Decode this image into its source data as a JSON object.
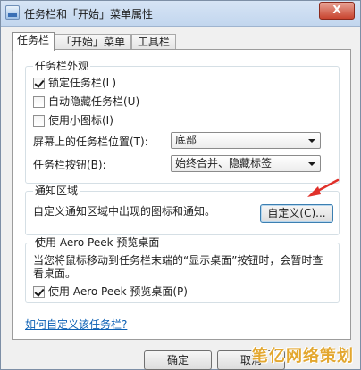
{
  "window": {
    "title": "任务栏和「开始」菜单属性",
    "close_label": "X"
  },
  "tabs": [
    {
      "label": "任务栏"
    },
    {
      "label": "「开始」菜单"
    },
    {
      "label": "工具栏"
    }
  ],
  "appearance": {
    "group_title": "任务栏外观",
    "lock_taskbar": {
      "label": "锁定任务栏(L)",
      "checked": true
    },
    "auto_hide": {
      "label": "自动隐藏任务栏(U)",
      "checked": false
    },
    "small_icons": {
      "label": "使用小图标(I)",
      "checked": false
    },
    "location_label": "屏幕上的任务栏位置(T):",
    "location_value": "底部",
    "buttons_label": "任务栏按钮(B):",
    "buttons_value": "始终合并、隐藏标签"
  },
  "notification": {
    "group_title": "通知区域",
    "description": "自定义通知区域中出现的图标和通知。",
    "customize_label": "自定义(C)..."
  },
  "aero_peek": {
    "group_title": "使用 Aero Peek 预览桌面",
    "description": "当您将鼠标移动到任务栏末端的“显示桌面”按钮时，会暂时查看桌面。",
    "checkbox": {
      "label": "使用 Aero Peek 预览桌面(P)",
      "checked": true
    }
  },
  "help_link": "如何自定义该任务栏?",
  "footer": {
    "ok_label": "确定",
    "cancel_label": "取消"
  },
  "watermark": "笔亿网络策划",
  "colors": {
    "annotation_arrow": "#e0302a",
    "link": "#0a5fb4"
  }
}
